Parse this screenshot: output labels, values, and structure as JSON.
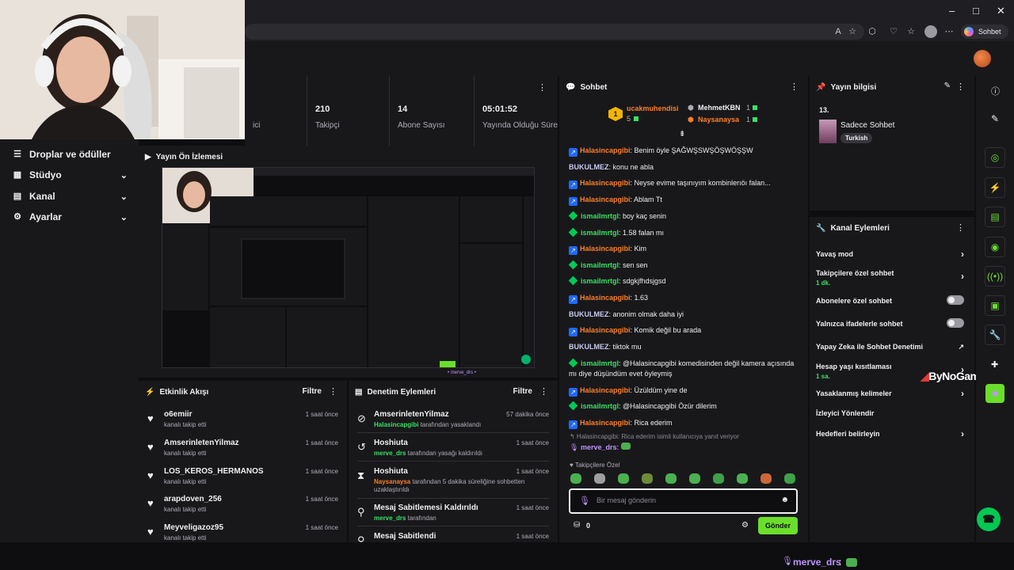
{
  "browser": {
    "copilot_label": "Sohbet et",
    "minimize": "–",
    "maximize": "□",
    "close": "✕"
  },
  "left_nav": {
    "items": [
      {
        "label": "Droplar ve ödüller",
        "icon": "drops-icon",
        "glyph": "☰"
      },
      {
        "label": "Stüdyo",
        "icon": "studio-icon",
        "glyph": "▦"
      },
      {
        "label": "Kanal",
        "icon": "channel-icon",
        "glyph": "▤"
      },
      {
        "label": "Ayarlar",
        "icon": "settings-icon",
        "glyph": "⚙"
      }
    ]
  },
  "stats": {
    "items": [
      {
        "value": "",
        "label": "ici"
      },
      {
        "value": "210",
        "label": "Takipçi"
      },
      {
        "value": "14",
        "label": "Abone Sayısı"
      },
      {
        "value": "05:01:52",
        "label": "Yayında Olduğu Süre"
      }
    ]
  },
  "preview": {
    "title": "Yayın Ön İzlemesi",
    "channel_tag": "• merve_drs •"
  },
  "activity": {
    "title": "Etkinlik Akışı",
    "filter": "Filtre",
    "rows": [
      {
        "name": "o6emiir",
        "sub": "kanalı takip etti",
        "time": "1 saat önce"
      },
      {
        "name": "AmserinletenYilmaz",
        "sub": "kanalı takip etti",
        "time": "1 saat önce"
      },
      {
        "name": "LOS_KEROS_HERMANOS",
        "sub": "kanalı takip etti",
        "time": "1 saat önce"
      },
      {
        "name": "arapdoven_256",
        "sub": "kanalı takip etti",
        "time": "1 saat önce"
      },
      {
        "name": "Meyveligazoz95",
        "sub": "kanalı takip etti",
        "time": "1 saat önce"
      }
    ]
  },
  "mod_actions": {
    "title": "Denetim Eylemleri",
    "filter": "Filtre",
    "rows": [
      {
        "name": "AmserinletenYilmaz",
        "actor": "Halasincapgibi",
        "sub": "tarafından yasaklandı",
        "time": "57 dakika önce",
        "glyph": "⊘"
      },
      {
        "name": "Hoshiuta",
        "actor": "merve_drs",
        "sub": "tarafından yasağı kaldırıldı",
        "time": "1 saat önce",
        "glyph": "↺"
      },
      {
        "name": "Hoshiuta",
        "actor": "Naysanaysa",
        "sub": "tarafından 5 dakika süreliğine sohbetten uzaklaştırıldı",
        "time": "1 saat önce",
        "glyph": "⧗"
      },
      {
        "name": "Mesaj Sabitlemesi Kaldırıldı",
        "actor": "merve_drs",
        "sub": "tarafından",
        "time": "1 saat önce",
        "glyph": "⚲"
      },
      {
        "name": "Mesaj Sabitlendi",
        "actor": "",
        "sub": "",
        "time": "1 saat önce",
        "glyph": "⚲"
      }
    ]
  },
  "chat": {
    "title": "Sohbet",
    "leaderboard": {
      "first_name": "ucakmuhendisi",
      "first_rank": "1",
      "first_count": "5",
      "second_name": "MehmetKBN",
      "second_count": "1",
      "third_name": "Naysanaysa",
      "third_count": "1"
    },
    "messages": [
      {
        "user": "Halasincapgibi",
        "color": "orange",
        "badge": "sq",
        "text": ": Benim öyle ŞAĞWŞSWŞÖŞWÖŞŞW"
      },
      {
        "user": "BUKULMEZ",
        "color": "plain",
        "badge": "",
        "text": ": konu ne abla"
      },
      {
        "user": "Halasincapgibi",
        "color": "orange",
        "badge": "sq",
        "text": ": Neyse evime taşınıyım kombinlerıöı falan..."
      },
      {
        "user": "Halasincapgibi",
        "color": "orange",
        "badge": "sq",
        "text": ": Ablam Tt"
      },
      {
        "user": "ismailmrtgl",
        "color": "green",
        "badge": "dm",
        "text": ": boy kaç senin"
      },
      {
        "user": "ismailmrtgl",
        "color": "green",
        "badge": "dm",
        "text": ": 1.58 falan mı"
      },
      {
        "user": "Halasincapgibi",
        "color": "orange",
        "badge": "sq",
        "text": ": Kim"
      },
      {
        "user": "ismailmrtgl",
        "color": "green",
        "badge": "dm",
        "text": ": sen sen"
      },
      {
        "user": "ismailmrtgl",
        "color": "green",
        "badge": "dm",
        "text": ": sdgkjfhdsjgsd"
      },
      {
        "user": "Halasincapgibi",
        "color": "orange",
        "badge": "sq",
        "text": ": 1.63"
      },
      {
        "user": "BUKULMEZ",
        "color": "plain",
        "badge": "",
        "text": ": anonim olmak daha iyi"
      },
      {
        "user": "Halasincapgibi",
        "color": "orange",
        "badge": "sq",
        "text": ": Komik değil bu arada"
      },
      {
        "user": "BUKULMEZ",
        "color": "plain",
        "badge": "",
        "text": ": tiktok mu"
      },
      {
        "user": "ismailmrtgl",
        "color": "green",
        "badge": "dm",
        "text": ": @Halasincapgibi komedisinden değil kamera açısında mı diye düşündüm evet öyleymiş"
      },
      {
        "user": "Halasincapgibi",
        "color": "orange",
        "badge": "sq",
        "text": ": Üzüldüm yine de"
      },
      {
        "user": "ismailmrtgl",
        "color": "green",
        "badge": "dm",
        "text": ": @Halasincapgibi Özür dilerim"
      },
      {
        "user": "Halasincapgibi",
        "color": "orange",
        "badge": "sq",
        "text": ": Rica ederim"
      }
    ],
    "reply_context": "↰ Halasincapgibi: Rica ederim isimli kullanıcıya yanıt veriyor",
    "reply_user": "merve_drs",
    "reply_sep": ":",
    "emote_label": "♥ Takipçilere Özel",
    "input_placeholder": "Bir mesaj gönderin",
    "points": "0",
    "send_label": "Gönder"
  },
  "stream_info": {
    "title": "Yayın bilgisi",
    "rank": "13.",
    "stream_title": "Sadece Sohbet",
    "tag": "Turkish"
  },
  "channel_actions": {
    "title": "Kanal Eylemleri",
    "rows": [
      {
        "label": "Yavaş mod",
        "sub": "",
        "control": "chevron"
      },
      {
        "label": "Takipçilere özel sohbet",
        "sub": "1 dk.",
        "control": "chevron"
      },
      {
        "label": "Abonelere özel sohbet",
        "sub": "",
        "control": "toggle"
      },
      {
        "label": "Yalnızca ifadelerle sohbet",
        "sub": "",
        "control": "toggle"
      },
      {
        "label": "Yapay Zeka ile Sohbet Denetimi",
        "sub": "",
        "control": "external"
      },
      {
        "label": "Hesap yaşı kısıtlaması",
        "sub": "1 sa.",
        "control": "chevron"
      },
      {
        "label": "Yasaklanmış kelimeler",
        "sub": "",
        "control": "chevron"
      },
      {
        "label": "İzleyici Yönlendir",
        "sub": "",
        "control": "none"
      },
      {
        "label": "Hedefleri belirleyin",
        "sub": "",
        "control": "chevron"
      }
    ]
  },
  "watermark": "ByNoGame",
  "bottom_bar": {
    "user": "merve_drs",
    "sep": ":"
  },
  "colors": {
    "accent": "#6bde2b",
    "orange_user": "#ff7f26",
    "green_user": "#3ae061",
    "panel": "#18181b",
    "bg": "#0e0e10"
  }
}
